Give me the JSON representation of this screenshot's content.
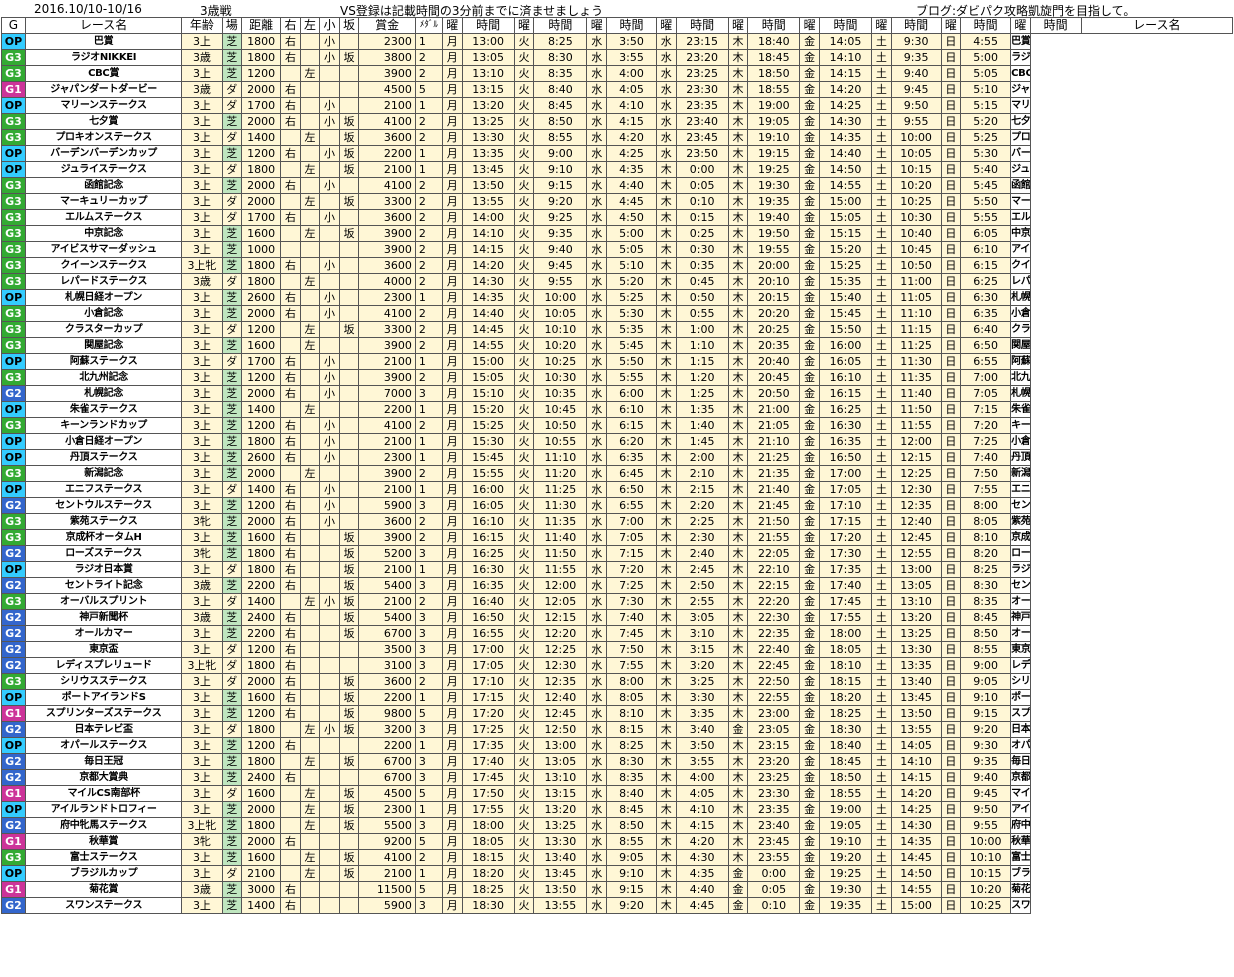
{
  "header": {
    "dates": "2016.10/10-10/16",
    "age_note": "3歳戦",
    "notice": "VS登録は記載時間の3分前までに済ませましょう",
    "blog": "ブログ:ダビパク攻略凱旋門を目指して。"
  },
  "columns": [
    "G",
    "レース名",
    "年齢",
    "場",
    "距離",
    "右",
    "左",
    "小",
    "坂",
    "賞金",
    "ﾒﾀﾞﾙ",
    "曜",
    "時間",
    "曜",
    "時間",
    "曜",
    "時間",
    "曜",
    "時間",
    "曜",
    "時間",
    "曜",
    "時間",
    "曜",
    "時間",
    "曜",
    "時間",
    "曜",
    "時間",
    "レース名"
  ],
  "colors": {
    "OP": "#33ccff",
    "G1": "#cc3399",
    "G2": "#3366cc",
    "G3": "#33aa33",
    "cream": "#fff7d6"
  },
  "rows": [
    [
      "OP",
      "巴賞",
      "3上",
      "芝",
      "1800",
      "右",
      "",
      "小",
      "",
      "2300",
      "1",
      "月",
      "13:00",
      "火",
      "8:25",
      "水",
      "3:50",
      "水",
      "23:15",
      "木",
      "18:40",
      "金",
      "14:05",
      "土",
      "9:30",
      "日",
      "4:55"
    ],
    [
      "G3",
      "ラジオNIKKEI",
      "3歳",
      "芝",
      "1800",
      "右",
      "",
      "小",
      "坂",
      "3800",
      "2",
      "月",
      "13:05",
      "火",
      "8:30",
      "水",
      "3:55",
      "水",
      "23:20",
      "木",
      "18:45",
      "金",
      "14:10",
      "土",
      "9:35",
      "日",
      "5:00"
    ],
    [
      "G3",
      "CBC賞",
      "3上",
      "芝",
      "1200",
      "",
      "左",
      "",
      "",
      "3900",
      "2",
      "月",
      "13:10",
      "火",
      "8:35",
      "水",
      "4:00",
      "水",
      "23:25",
      "木",
      "18:50",
      "金",
      "14:15",
      "土",
      "9:40",
      "日",
      "5:05"
    ],
    [
      "G1",
      "ジャパンダートダービー",
      "3歳",
      "ダ",
      "2000",
      "右",
      "",
      "",
      "",
      "4500",
      "5",
      "月",
      "13:15",
      "火",
      "8:40",
      "水",
      "4:05",
      "水",
      "23:30",
      "木",
      "18:55",
      "金",
      "14:20",
      "土",
      "9:45",
      "日",
      "5:10"
    ],
    [
      "OP",
      "マリーンステークス",
      "3上",
      "ダ",
      "1700",
      "右",
      "",
      "小",
      "",
      "2100",
      "1",
      "月",
      "13:20",
      "火",
      "8:45",
      "水",
      "4:10",
      "水",
      "23:35",
      "木",
      "19:00",
      "金",
      "14:25",
      "土",
      "9:50",
      "日",
      "5:15"
    ],
    [
      "G3",
      "七夕賞",
      "3上",
      "芝",
      "2000",
      "右",
      "",
      "小",
      "坂",
      "4100",
      "2",
      "月",
      "13:25",
      "火",
      "8:50",
      "水",
      "4:15",
      "水",
      "23:40",
      "木",
      "19:05",
      "金",
      "14:30",
      "土",
      "9:55",
      "日",
      "5:20"
    ],
    [
      "G3",
      "プロキオンステークス",
      "3上",
      "ダ",
      "1400",
      "",
      "左",
      "",
      "坂",
      "3600",
      "2",
      "月",
      "13:30",
      "火",
      "8:55",
      "水",
      "4:20",
      "水",
      "23:45",
      "木",
      "19:10",
      "金",
      "14:35",
      "土",
      "10:00",
      "日",
      "5:25"
    ],
    [
      "OP",
      "バーデンバーデンカップ",
      "3上",
      "芝",
      "1200",
      "右",
      "",
      "小",
      "坂",
      "2200",
      "1",
      "月",
      "13:35",
      "火",
      "9:00",
      "水",
      "4:25",
      "水",
      "23:50",
      "木",
      "19:15",
      "金",
      "14:40",
      "土",
      "10:05",
      "日",
      "5:30"
    ],
    [
      "OP",
      "ジュライステークス",
      "3上",
      "ダ",
      "1800",
      "",
      "左",
      "",
      "坂",
      "2100",
      "1",
      "月",
      "13:45",
      "火",
      "9:10",
      "水",
      "4:35",
      "木",
      "0:00",
      "木",
      "19:25",
      "金",
      "14:50",
      "土",
      "10:15",
      "日",
      "5:40"
    ],
    [
      "G3",
      "函館記念",
      "3上",
      "芝",
      "2000",
      "右",
      "",
      "小",
      "",
      "4100",
      "2",
      "月",
      "13:50",
      "火",
      "9:15",
      "水",
      "4:40",
      "木",
      "0:05",
      "木",
      "19:30",
      "金",
      "14:55",
      "土",
      "10:20",
      "日",
      "5:45"
    ],
    [
      "G3",
      "マーキュリーカップ",
      "3上",
      "ダ",
      "2000",
      "",
      "左",
      "",
      "坂",
      "3300",
      "2",
      "月",
      "13:55",
      "火",
      "9:20",
      "水",
      "4:45",
      "木",
      "0:10",
      "木",
      "19:35",
      "金",
      "15:00",
      "土",
      "10:25",
      "日",
      "5:50"
    ],
    [
      "G3",
      "エルムステークス",
      "3上",
      "ダ",
      "1700",
      "右",
      "",
      "小",
      "",
      "3600",
      "2",
      "月",
      "14:00",
      "火",
      "9:25",
      "水",
      "4:50",
      "木",
      "0:15",
      "木",
      "19:40",
      "金",
      "15:05",
      "土",
      "10:30",
      "日",
      "5:55"
    ],
    [
      "G3",
      "中京記念",
      "3上",
      "芝",
      "1600",
      "",
      "左",
      "",
      "坂",
      "3900",
      "2",
      "月",
      "14:10",
      "火",
      "9:35",
      "水",
      "5:00",
      "木",
      "0:25",
      "木",
      "19:50",
      "金",
      "15:15",
      "土",
      "10:40",
      "日",
      "6:05"
    ],
    [
      "G3",
      "アイビスサマーダッシュ",
      "3上",
      "芝",
      "1000",
      "",
      "",
      "",
      "",
      "3900",
      "2",
      "月",
      "14:15",
      "火",
      "9:40",
      "水",
      "5:05",
      "木",
      "0:30",
      "木",
      "19:55",
      "金",
      "15:20",
      "土",
      "10:45",
      "日",
      "6:10"
    ],
    [
      "G3",
      "クイーンステークス",
      "3上牝",
      "芝",
      "1800",
      "右",
      "",
      "小",
      "",
      "3600",
      "2",
      "月",
      "14:20",
      "火",
      "9:45",
      "水",
      "5:10",
      "木",
      "0:35",
      "木",
      "20:00",
      "金",
      "15:25",
      "土",
      "10:50",
      "日",
      "6:15"
    ],
    [
      "G3",
      "レパードステークス",
      "3歳",
      "ダ",
      "1800",
      "",
      "左",
      "",
      "",
      "4000",
      "2",
      "月",
      "14:30",
      "火",
      "9:55",
      "水",
      "5:20",
      "木",
      "0:45",
      "木",
      "20:10",
      "金",
      "15:35",
      "土",
      "11:00",
      "日",
      "6:25"
    ],
    [
      "OP",
      "札幌日経オープン",
      "3上",
      "芝",
      "2600",
      "右",
      "",
      "小",
      "",
      "2300",
      "1",
      "月",
      "14:35",
      "火",
      "10:00",
      "水",
      "5:25",
      "木",
      "0:50",
      "木",
      "20:15",
      "金",
      "15:40",
      "土",
      "11:05",
      "日",
      "6:30"
    ],
    [
      "G3",
      "小倉記念",
      "3上",
      "芝",
      "2000",
      "右",
      "",
      "小",
      "",
      "4100",
      "2",
      "月",
      "14:40",
      "火",
      "10:05",
      "水",
      "5:30",
      "木",
      "0:55",
      "木",
      "20:20",
      "金",
      "15:45",
      "土",
      "11:10",
      "日",
      "6:35"
    ],
    [
      "G3",
      "クラスターカップ",
      "3上",
      "ダ",
      "1200",
      "",
      "左",
      "",
      "坂",
      "3300",
      "2",
      "月",
      "14:45",
      "火",
      "10:10",
      "水",
      "5:35",
      "木",
      "1:00",
      "木",
      "20:25",
      "金",
      "15:50",
      "土",
      "11:15",
      "日",
      "6:40"
    ],
    [
      "G3",
      "関屋記念",
      "3上",
      "芝",
      "1600",
      "",
      "左",
      "",
      "",
      "3900",
      "2",
      "月",
      "14:55",
      "火",
      "10:20",
      "水",
      "5:45",
      "木",
      "1:10",
      "木",
      "20:35",
      "金",
      "16:00",
      "土",
      "11:25",
      "日",
      "6:50"
    ],
    [
      "OP",
      "阿蘇ステークス",
      "3上",
      "ダ",
      "1700",
      "右",
      "",
      "小",
      "",
      "2100",
      "1",
      "月",
      "15:00",
      "火",
      "10:25",
      "水",
      "5:50",
      "木",
      "1:15",
      "木",
      "20:40",
      "金",
      "16:05",
      "土",
      "11:30",
      "日",
      "6:55"
    ],
    [
      "G3",
      "北九州記念",
      "3上",
      "芝",
      "1200",
      "右",
      "",
      "小",
      "",
      "3900",
      "2",
      "月",
      "15:05",
      "火",
      "10:30",
      "水",
      "5:55",
      "木",
      "1:20",
      "木",
      "20:45",
      "金",
      "16:10",
      "土",
      "11:35",
      "日",
      "7:00"
    ],
    [
      "G2",
      "札幌記念",
      "3上",
      "芝",
      "2000",
      "右",
      "",
      "小",
      "",
      "7000",
      "3",
      "月",
      "15:10",
      "火",
      "10:35",
      "水",
      "6:00",
      "木",
      "1:25",
      "木",
      "20:50",
      "金",
      "16:15",
      "土",
      "11:40",
      "日",
      "7:05"
    ],
    [
      "OP",
      "朱雀ステークス",
      "3上",
      "芝",
      "1400",
      "",
      "左",
      "",
      "",
      "2200",
      "1",
      "月",
      "15:20",
      "火",
      "10:45",
      "水",
      "6:10",
      "木",
      "1:35",
      "木",
      "21:00",
      "金",
      "16:25",
      "土",
      "11:50",
      "日",
      "7:15"
    ],
    [
      "G3",
      "キーンランドカップ",
      "3上",
      "芝",
      "1200",
      "右",
      "",
      "小",
      "",
      "4100",
      "2",
      "月",
      "15:25",
      "火",
      "10:50",
      "水",
      "6:15",
      "木",
      "1:40",
      "木",
      "21:05",
      "金",
      "16:30",
      "土",
      "11:55",
      "日",
      "7:20"
    ],
    [
      "OP",
      "小倉日経オープン",
      "3上",
      "芝",
      "1800",
      "右",
      "",
      "小",
      "",
      "2100",
      "1",
      "月",
      "15:30",
      "火",
      "10:55",
      "水",
      "6:20",
      "木",
      "1:45",
      "木",
      "21:10",
      "金",
      "16:35",
      "土",
      "12:00",
      "日",
      "7:25"
    ],
    [
      "OP",
      "丹頂ステークス",
      "3上",
      "芝",
      "2600",
      "右",
      "",
      "小",
      "",
      "2300",
      "1",
      "月",
      "15:45",
      "火",
      "11:10",
      "水",
      "6:35",
      "木",
      "2:00",
      "木",
      "21:25",
      "金",
      "16:50",
      "土",
      "12:15",
      "日",
      "7:40"
    ],
    [
      "G3",
      "新潟記念",
      "3上",
      "芝",
      "2000",
      "",
      "左",
      "",
      "",
      "3900",
      "2",
      "月",
      "15:55",
      "火",
      "11:20",
      "水",
      "6:45",
      "木",
      "2:10",
      "木",
      "21:35",
      "金",
      "17:00",
      "土",
      "12:25",
      "日",
      "7:50"
    ],
    [
      "OP",
      "エニフステークス",
      "3上",
      "ダ",
      "1400",
      "右",
      "",
      "小",
      "",
      "2100",
      "1",
      "月",
      "16:00",
      "火",
      "11:25",
      "水",
      "6:50",
      "木",
      "2:15",
      "木",
      "21:40",
      "金",
      "17:05",
      "土",
      "12:30",
      "日",
      "7:55"
    ],
    [
      "G2",
      "セントウルステークス",
      "3上",
      "芝",
      "1200",
      "右",
      "",
      "小",
      "",
      "5900",
      "3",
      "月",
      "16:05",
      "火",
      "11:30",
      "水",
      "6:55",
      "木",
      "2:20",
      "木",
      "21:45",
      "金",
      "17:10",
      "土",
      "12:35",
      "日",
      "8:00"
    ],
    [
      "G3",
      "紫苑ステークス",
      "3牝",
      "芝",
      "2000",
      "右",
      "",
      "小",
      "",
      "3600",
      "2",
      "月",
      "16:10",
      "火",
      "11:35",
      "水",
      "7:00",
      "木",
      "2:25",
      "木",
      "21:50",
      "金",
      "17:15",
      "土",
      "12:40",
      "日",
      "8:05"
    ],
    [
      "G3",
      "京成杯オータムH",
      "3上",
      "芝",
      "1600",
      "右",
      "",
      "",
      "坂",
      "3900",
      "2",
      "月",
      "16:15",
      "火",
      "11:40",
      "水",
      "7:05",
      "木",
      "2:30",
      "木",
      "21:55",
      "金",
      "17:20",
      "土",
      "12:45",
      "日",
      "8:10"
    ],
    [
      "G2",
      "ローズステークス",
      "3牝",
      "芝",
      "1800",
      "右",
      "",
      "",
      "坂",
      "5200",
      "3",
      "月",
      "16:25",
      "火",
      "11:50",
      "水",
      "7:15",
      "木",
      "2:40",
      "木",
      "22:05",
      "金",
      "17:30",
      "土",
      "12:55",
      "日",
      "8:20"
    ],
    [
      "OP",
      "ラジオ日本賞",
      "3上",
      "ダ",
      "1800",
      "右",
      "",
      "",
      "坂",
      "2100",
      "1",
      "月",
      "16:30",
      "火",
      "11:55",
      "水",
      "7:20",
      "木",
      "2:45",
      "木",
      "22:10",
      "金",
      "17:35",
      "土",
      "13:00",
      "日",
      "8:25"
    ],
    [
      "G2",
      "セントライト記念",
      "3歳",
      "芝",
      "2200",
      "右",
      "",
      "",
      "坂",
      "5400",
      "3",
      "月",
      "16:35",
      "火",
      "12:00",
      "水",
      "7:25",
      "木",
      "2:50",
      "木",
      "22:15",
      "金",
      "17:40",
      "土",
      "13:05",
      "日",
      "8:30"
    ],
    [
      "G3",
      "オーバルスプリント",
      "3上",
      "ダ",
      "1400",
      "",
      "左",
      "小",
      "坂",
      "2100",
      "2",
      "月",
      "16:40",
      "火",
      "12:05",
      "水",
      "7:30",
      "木",
      "2:55",
      "木",
      "22:20",
      "金",
      "17:45",
      "土",
      "13:10",
      "日",
      "8:35"
    ],
    [
      "G2",
      "神戸新聞杯",
      "3歳",
      "芝",
      "2400",
      "右",
      "",
      "",
      "坂",
      "5400",
      "3",
      "月",
      "16:50",
      "火",
      "12:15",
      "水",
      "7:40",
      "木",
      "3:05",
      "木",
      "22:30",
      "金",
      "17:55",
      "土",
      "13:20",
      "日",
      "8:45"
    ],
    [
      "G2",
      "オールカマー",
      "3上",
      "芝",
      "2200",
      "右",
      "",
      "",
      "坂",
      "6700",
      "3",
      "月",
      "16:55",
      "火",
      "12:20",
      "水",
      "7:45",
      "木",
      "3:10",
      "木",
      "22:35",
      "金",
      "18:00",
      "土",
      "13:25",
      "日",
      "8:50"
    ],
    [
      "G2",
      "東京盃",
      "3上",
      "ダ",
      "1200",
      "右",
      "",
      "",
      "",
      "3500",
      "3",
      "月",
      "17:00",
      "火",
      "12:25",
      "水",
      "7:50",
      "木",
      "3:15",
      "木",
      "22:40",
      "金",
      "18:05",
      "土",
      "13:30",
      "日",
      "8:55"
    ],
    [
      "G2",
      "レディスプレリュード",
      "3上牝",
      "ダ",
      "1800",
      "右",
      "",
      "",
      "",
      "3100",
      "3",
      "月",
      "17:05",
      "火",
      "12:30",
      "水",
      "7:55",
      "木",
      "3:20",
      "木",
      "22:45",
      "金",
      "18:10",
      "土",
      "13:35",
      "日",
      "9:00"
    ],
    [
      "G3",
      "シリウスステークス",
      "3上",
      "ダ",
      "2000",
      "右",
      "",
      "",
      "坂",
      "3600",
      "2",
      "月",
      "17:10",
      "火",
      "12:35",
      "水",
      "8:00",
      "木",
      "3:25",
      "木",
      "22:50",
      "金",
      "18:15",
      "土",
      "13:40",
      "日",
      "9:05"
    ],
    [
      "OP",
      "ポートアイランドS",
      "3上",
      "芝",
      "1600",
      "右",
      "",
      "",
      "坂",
      "2200",
      "1",
      "月",
      "17:15",
      "火",
      "12:40",
      "水",
      "8:05",
      "木",
      "3:30",
      "木",
      "22:55",
      "金",
      "18:20",
      "土",
      "13:45",
      "日",
      "9:10"
    ],
    [
      "G1",
      "スプリンターズステークス",
      "3上",
      "芝",
      "1200",
      "右",
      "",
      "",
      "坂",
      "9800",
      "5",
      "月",
      "17:20",
      "火",
      "12:45",
      "水",
      "8:10",
      "木",
      "3:35",
      "木",
      "23:00",
      "金",
      "18:25",
      "土",
      "13:50",
      "日",
      "9:15"
    ],
    [
      "G2",
      "日本テレビ盃",
      "3上",
      "ダ",
      "1800",
      "",
      "左",
      "小",
      "坂",
      "3200",
      "3",
      "月",
      "17:25",
      "火",
      "12:50",
      "水",
      "8:15",
      "木",
      "3:40",
      "金",
      "23:05",
      "金",
      "18:30",
      "土",
      "13:55",
      "日",
      "9:20"
    ],
    [
      "OP",
      "オパールステークス",
      "3上",
      "芝",
      "1200",
      "右",
      "",
      "",
      "",
      "2200",
      "1",
      "月",
      "17:35",
      "火",
      "13:00",
      "水",
      "8:25",
      "木",
      "3:50",
      "木",
      "23:15",
      "金",
      "18:40",
      "土",
      "14:05",
      "日",
      "9:30"
    ],
    [
      "G2",
      "毎日王冠",
      "3上",
      "芝",
      "1800",
      "",
      "左",
      "",
      "坂",
      "6700",
      "3",
      "月",
      "17:40",
      "火",
      "13:05",
      "水",
      "8:30",
      "木",
      "3:55",
      "木",
      "23:20",
      "金",
      "18:45",
      "土",
      "14:10",
      "日",
      "9:35"
    ],
    [
      "G2",
      "京都大賞典",
      "3上",
      "芝",
      "2400",
      "右",
      "",
      "",
      "",
      "6700",
      "3",
      "月",
      "17:45",
      "火",
      "13:10",
      "水",
      "8:35",
      "木",
      "4:00",
      "木",
      "23:25",
      "金",
      "18:50",
      "土",
      "14:15",
      "日",
      "9:40"
    ],
    [
      "G1",
      "マイルCS南部杯",
      "3上",
      "ダ",
      "1600",
      "",
      "左",
      "",
      "坂",
      "4500",
      "5",
      "月",
      "17:50",
      "火",
      "13:15",
      "水",
      "8:40",
      "木",
      "4:05",
      "木",
      "23:30",
      "金",
      "18:55",
      "土",
      "14:20",
      "日",
      "9:45"
    ],
    [
      "OP",
      "アイルランドトロフィー",
      "3上",
      "芝",
      "2000",
      "",
      "左",
      "",
      "坂",
      "2300",
      "1",
      "月",
      "17:55",
      "火",
      "13:20",
      "水",
      "8:45",
      "木",
      "4:10",
      "木",
      "23:35",
      "金",
      "19:00",
      "土",
      "14:25",
      "日",
      "9:50"
    ],
    [
      "G2",
      "府中牝馬ステークス",
      "3上牝",
      "芝",
      "1800",
      "",
      "左",
      "",
      "坂",
      "5500",
      "3",
      "月",
      "18:00",
      "火",
      "13:25",
      "水",
      "8:50",
      "木",
      "4:15",
      "木",
      "23:40",
      "金",
      "19:05",
      "土",
      "14:30",
      "日",
      "9:55"
    ],
    [
      "G1",
      "秋華賞",
      "3牝",
      "芝",
      "2000",
      "右",
      "",
      "",
      "",
      "9200",
      "5",
      "月",
      "18:05",
      "火",
      "13:30",
      "水",
      "8:55",
      "木",
      "4:20",
      "木",
      "23:45",
      "金",
      "19:10",
      "土",
      "14:35",
      "日",
      "10:00"
    ],
    [
      "G3",
      "富士ステークス",
      "3上",
      "芝",
      "1600",
      "",
      "左",
      "",
      "坂",
      "4100",
      "2",
      "月",
      "18:15",
      "火",
      "13:40",
      "水",
      "9:05",
      "木",
      "4:30",
      "木",
      "23:55",
      "金",
      "19:20",
      "土",
      "14:45",
      "日",
      "10:10"
    ],
    [
      "OP",
      "ブラジルカップ",
      "3上",
      "ダ",
      "2100",
      "",
      "左",
      "",
      "坂",
      "2100",
      "1",
      "月",
      "18:20",
      "火",
      "13:45",
      "水",
      "9:10",
      "木",
      "4:35",
      "金",
      "0:00",
      "金",
      "19:25",
      "土",
      "14:50",
      "日",
      "10:15"
    ],
    [
      "G1",
      "菊花賞",
      "3歳",
      "芝",
      "3000",
      "右",
      "",
      "",
      "",
      "11500",
      "5",
      "月",
      "18:25",
      "火",
      "13:50",
      "水",
      "9:15",
      "木",
      "4:40",
      "金",
      "0:05",
      "金",
      "19:30",
      "土",
      "14:55",
      "日",
      "10:20"
    ],
    [
      "G2",
      "スワンステークス",
      "3上",
      "芝",
      "1400",
      "右",
      "",
      "",
      "",
      "5900",
      "3",
      "月",
      "18:30",
      "火",
      "13:55",
      "水",
      "9:20",
      "木",
      "4:45",
      "金",
      "0:10",
      "金",
      "19:35",
      "土",
      "15:00",
      "日",
      "10:25"
    ]
  ]
}
